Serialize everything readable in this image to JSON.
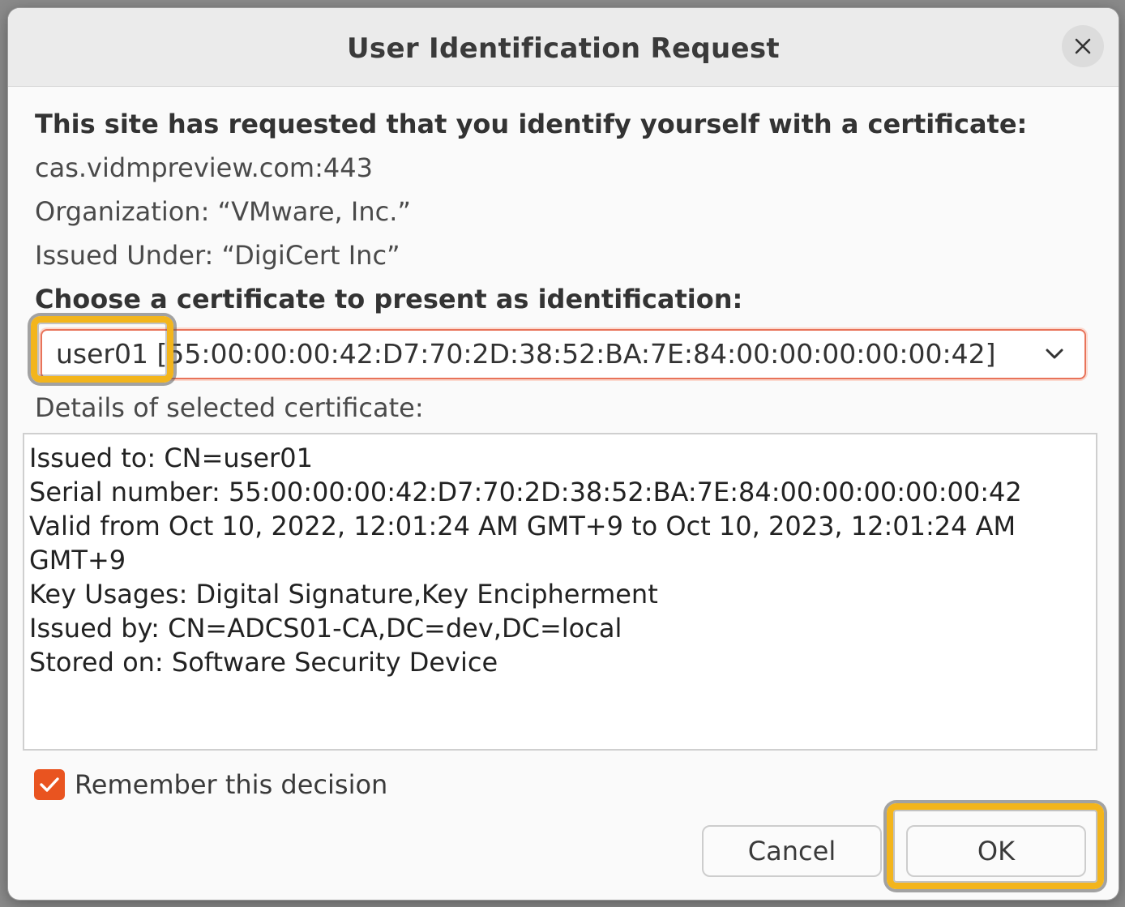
{
  "dialog": {
    "title": "User Identification Request"
  },
  "request": {
    "heading": "This site has requested that you identify yourself with a certificate:",
    "host": "cas.vidmpreview.com:443",
    "organization": "Organization: “VMware, Inc.”",
    "issued_under": "Issued Under: “DigiCert Inc”"
  },
  "certificate": {
    "choose_label": "Choose a certificate to present as identification:",
    "selected_value": "user01 [55:00:00:00:42:D7:70:2D:38:52:BA:7E:84:00:00:00:00:00:42]",
    "details_label": "Details of selected certificate:",
    "details": [
      "Issued to: CN=user01",
      "Serial number: 55:00:00:00:42:D7:70:2D:38:52:BA:7E:84:00:00:00:00:00:42",
      "Valid from Oct 10, 2022, 12:01:24 AM GMT+9 to Oct 10, 2023, 12:01:24 AM GMT+9",
      "Key Usages: Digital Signature,Key Encipherment",
      "Issued by: CN=ADCS01-CA,DC=dev,DC=local",
      "Stored on: Software Security Device"
    ]
  },
  "remember": {
    "label": "Remember this decision",
    "checked": true
  },
  "buttons": {
    "cancel": "Cancel",
    "ok": "OK"
  },
  "colors": {
    "accent": "#e95420",
    "highlight": "#f3b51c",
    "select_border": "#e8735a"
  },
  "icons": {
    "close": "close-icon",
    "dropdown": "chevron-down-icon",
    "check": "checkmark-icon"
  }
}
